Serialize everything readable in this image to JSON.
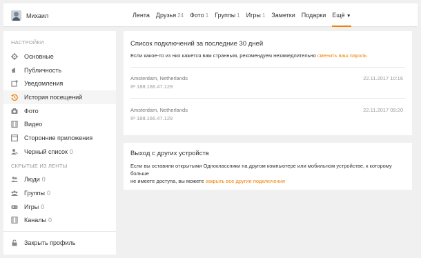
{
  "header": {
    "user_name": "Михаил",
    "nav": [
      {
        "label": "Лента",
        "count": ""
      },
      {
        "label": "Друзья",
        "count": "24"
      },
      {
        "label": "Фото",
        "count": "1"
      },
      {
        "label": "Группы",
        "count": "1"
      },
      {
        "label": "Игры",
        "count": "1"
      },
      {
        "label": "Заметки",
        "count": ""
      },
      {
        "label": "Подарки",
        "count": ""
      },
      {
        "label": "Ещё",
        "count": ""
      }
    ],
    "more_caret": "▼",
    "active_color": "#ee8208"
  },
  "sidebar": {
    "settings_heading": "НАСТРОЙКИ",
    "settings_items": [
      {
        "label": "Основные",
        "icon": "gear-icon",
        "count": ""
      },
      {
        "label": "Публичность",
        "icon": "megaphone-icon",
        "count": ""
      },
      {
        "label": "Уведомления",
        "icon": "notification-icon",
        "count": ""
      },
      {
        "label": "История посещений",
        "icon": "history-icon",
        "count": ""
      },
      {
        "label": "Фото",
        "icon": "camera-icon",
        "count": ""
      },
      {
        "label": "Видео",
        "icon": "film-icon",
        "count": ""
      },
      {
        "label": "Сторонние приложения",
        "icon": "apps-icon",
        "count": ""
      },
      {
        "label": "Черный список",
        "icon": "blacklist-icon",
        "count": "0"
      }
    ],
    "hidden_heading": "СКРЫТЫЕ ИЗ ЛЕНТЫ",
    "hidden_items": [
      {
        "label": "Люди",
        "icon": "people-icon",
        "count": "0"
      },
      {
        "label": "Группы",
        "icon": "groups-icon",
        "count": "0"
      },
      {
        "label": "Игры",
        "icon": "games-icon",
        "count": "0"
      },
      {
        "label": "Каналы",
        "icon": "channels-icon",
        "count": "0"
      }
    ],
    "close_profile": {
      "label": "Закрыть профиль",
      "icon": "lock-icon"
    }
  },
  "sessions_card": {
    "title": "Список подключений за последние 30 дней",
    "note_text": "Если какое-то из них кажется вам странным, рекомендуем незамедлительно ",
    "note_link": "сменить ваш пароль",
    "sessions": [
      {
        "location": "Amsterdam, Netherlands",
        "ip": "IP 188.166.47.129",
        "datetime": "22.11.2017 10:16"
      },
      {
        "location": "Amsterdam, Netherlands",
        "ip": "IP 188.166.47.129",
        "datetime": "22.11.2017 09:20"
      }
    ]
  },
  "logout_card": {
    "title": "Выход с других устройств",
    "text_line1": "Если вы оставили открытыми Одноклассники на другом компьютере или мобильном устройстве, к которому больше",
    "text_line2": "не имеете доступа, вы можете ",
    "link": "закрыть все другие подключения"
  }
}
